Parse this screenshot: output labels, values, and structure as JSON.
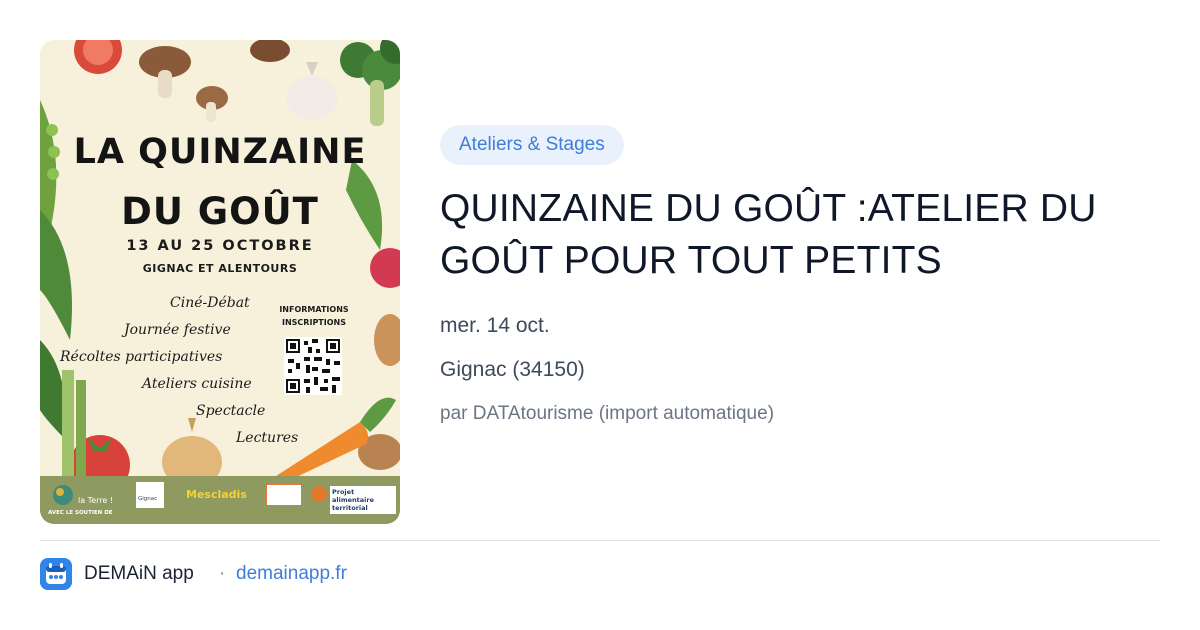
{
  "poster": {
    "title_line1": "LA QUINZAINE",
    "title_line2": "DU GOÛT",
    "dates": "13 AU 25 OCTOBRE",
    "place": "GIGNAC ET ALENTOURS",
    "activities": [
      "Ciné-Débat",
      "Journée festive",
      "Récoltes participatives",
      "Ateliers cuisine",
      "Spectacle",
      "Lectures"
    ],
    "info_label": "INFORMATIONS INSCRIPTIONS",
    "logos": [
      "la Terre !",
      "Gignac",
      "Mescladis",
      "Projet alimentaire territorial"
    ],
    "support_label": "AVEC LE SOUTIEN DE"
  },
  "event": {
    "category": "Ateliers & Stages",
    "title": "QUINZAINE DU GOÛT :ATELIER DU GOÛT POUR TOUT PETITS",
    "date": "mer. 14 oct.",
    "location": "Gignac (34150)",
    "source": "par DATAtourisme (import automatique)"
  },
  "footer": {
    "app_name": "DEMAiN app",
    "separator": "·",
    "domain": "demainapp.fr",
    "icon": "demain-app-icon"
  },
  "colors": {
    "accent": "#3f7ed8",
    "chip_bg": "#e9f1fc",
    "poster_bg": "#f7f1dc",
    "poster_band": "#8e9a60"
  }
}
